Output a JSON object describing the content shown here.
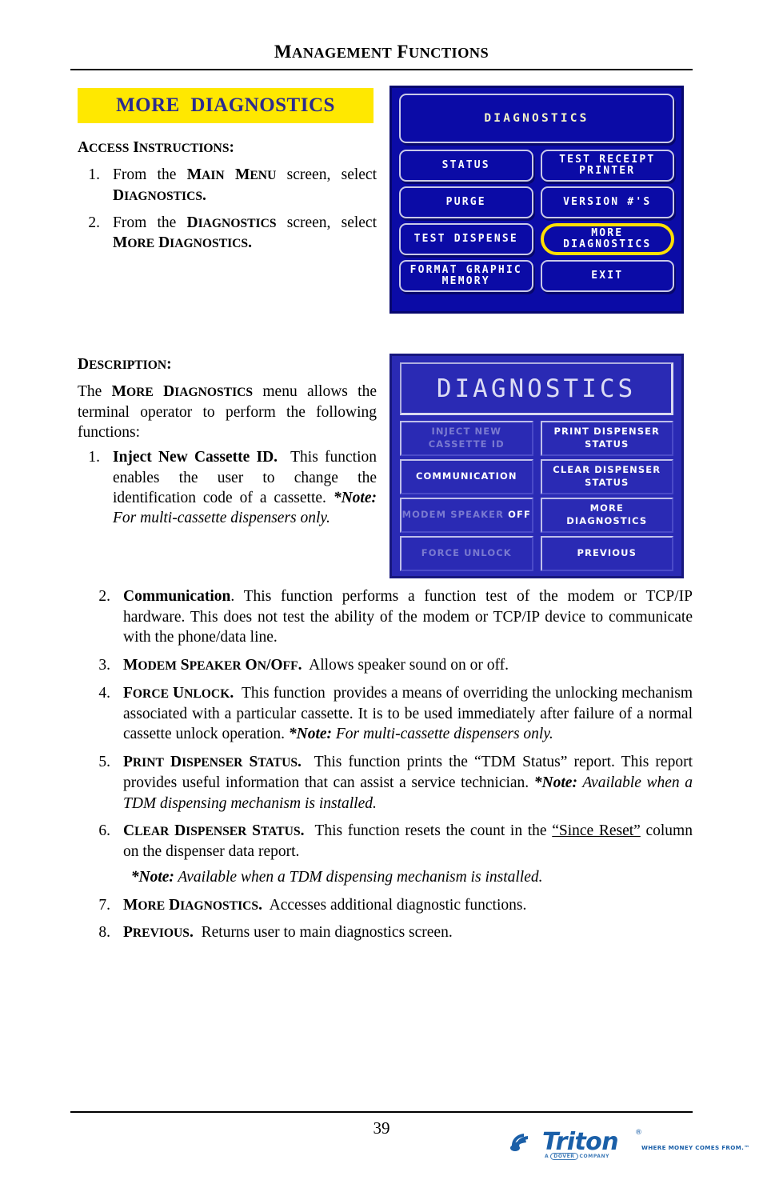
{
  "document": {
    "running_header": "MANAGEMENT FUNCTIONS",
    "page_number": "39"
  },
  "title_banner": {
    "label": "MORE  DIAGNOSTICS",
    "background": "#FFE800",
    "text_color": "#2B2B8F"
  },
  "access_instructions": {
    "heading": "ACCESS INSTRUCTIONS:",
    "items": [
      {
        "number": "1.",
        "parts": [
          {
            "text": "From the ",
            "style": "normal"
          },
          {
            "text": "MAIN MENU",
            "style": "smallcaps-bold"
          },
          {
            "text": " screen, select ",
            "style": "normal"
          },
          {
            "text": "DIAGNOSTICS.",
            "style": "smallcaps-bold"
          }
        ]
      },
      {
        "number": "2.",
        "parts": [
          {
            "text": "From the ",
            "style": "normal"
          },
          {
            "text": "DIAGNOSTICS",
            "style": "smallcaps-bold"
          },
          {
            "text": " screen, select ",
            "style": "normal"
          },
          {
            "text": "MORE DIAGNOSTICS.",
            "style": "smallcaps-bold"
          }
        ]
      }
    ]
  },
  "description": {
    "heading": "DESCRIPTION:",
    "intro_pre": "The ",
    "intro_bold": "MORE DIAGNOSTICS",
    "intro_post": " menu allows the terminal operator to perform the following functions:",
    "items": [
      {
        "number": "1.",
        "title": "Inject New Cassette ID.",
        "body": "  This function enables the user to change the identification code of a cassette. ",
        "note_label": "*Note:",
        "note_text": " For multi-cassette dispensers only."
      },
      {
        "number": "2.",
        "title": "Communication",
        "body": ". This function performs a function test of the modem or TCP/IP hardware. This does not test the ability of the modem or TCP/IP device to communicate with the phone/data line.",
        "note_label": "",
        "note_text": ""
      },
      {
        "number": "3.",
        "title": "MODEM SPEAKER ON/OFF.",
        "body": "  Allows speaker sound on or off.",
        "note_label": "",
        "note_text": ""
      },
      {
        "number": "4.",
        "title": "FORCE UNLOCK.",
        "body": "  This function  provides a means of overriding the unlocking mechanism associated with a particular cassette. It is to be used immediately after failure of a normal cassette unlock operation. ",
        "note_label": "*Note:",
        "note_text": " For multi-cassette dispensers only.",
        "note_inline": true
      },
      {
        "number": "5.",
        "title": "PRINT DISPENSER STATUS.",
        "body": "  This function prints the “TDM Status” report. This report provides useful information that can assist a service technician. ",
        "note_label": "*Note:",
        "note_text": " Available when a TDM dispensing mechanism is installed.",
        "note_inline": true
      },
      {
        "number": "6.",
        "title": "CLEAR DISPENSER STATUS.",
        "body_pre": "  This function resets the count in the ",
        "body_underline": "“Since Reset”",
        "body_post": " column on the dispenser data report.",
        "note_label": "*Note:",
        "note_text": " Available when a TDM dispensing mechanism is installed.",
        "note_inline": false
      },
      {
        "number": "7.",
        "title": "MORE DIAGNOSTICS.",
        "body": "  Accesses additional diagnostic functions.",
        "note_label": "",
        "note_text": ""
      },
      {
        "number": "8.",
        "title": "PREVIOUS.",
        "body": "  Returns user to main diagnostics screen.",
        "note_label": "",
        "note_text": ""
      }
    ]
  },
  "atm_screen_1": {
    "title": "DIAGNOSTICS",
    "background": "#0B0BA6",
    "title_color": "#F4F4C8",
    "highlight_color": "#FFE000",
    "buttons": [
      {
        "label": "STATUS",
        "highlighted": false
      },
      {
        "label": "TEST RECEIPT\nPRINTER",
        "highlighted": false
      },
      {
        "label": "PURGE",
        "highlighted": false
      },
      {
        "label": "VERSION #'S",
        "highlighted": false
      },
      {
        "label": "TEST DISPENSE",
        "highlighted": false
      },
      {
        "label": "MORE\nDIAGNOSTICS",
        "highlighted": true
      },
      {
        "label": "FORMAT GRAPHIC\nMEMORY",
        "highlighted": false
      },
      {
        "label": "EXIT",
        "highlighted": false
      }
    ]
  },
  "atm_screen_2": {
    "title": "DIAGNOSTICS",
    "background": "#2A2AB4",
    "title_color": "#DCDCF4",
    "buttons": [
      {
        "label": "INJECT NEW\nCASSETTE ID",
        "dimmed": true
      },
      {
        "label": "PRINT DISPENSER\nSTATUS",
        "dimmed": false
      },
      {
        "label": "COMMUNICATION",
        "dimmed": false
      },
      {
        "label": "CLEAR DISPENSER\nSTATUS",
        "dimmed": false
      },
      {
        "label": "MODEM SPEAKER ",
        "state": "OFF",
        "dimmed": true
      },
      {
        "label": "MORE\nDIAGNOSTICS",
        "dimmed": false
      },
      {
        "label": "FORCE UNLOCK",
        "dimmed": true
      },
      {
        "label": "PREVIOUS",
        "dimmed": false
      }
    ]
  },
  "footer": {
    "logo_wordmark": "Triton",
    "logo_registered": "®",
    "logo_tagline": "WHERE MONEY COMES FROM.™",
    "logo_parent_pre": "A",
    "logo_parent_box": "DOVER",
    "logo_parent_post": "COMPANY",
    "logo_color": "#1A5FA8"
  }
}
